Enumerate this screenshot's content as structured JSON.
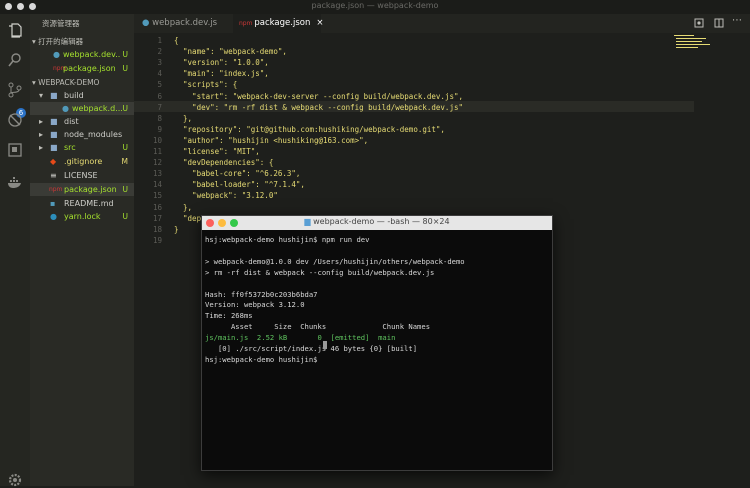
{
  "window": {
    "title": "package.json — webpack-demo"
  },
  "activity": {
    "scm_badge": "6",
    "icons": [
      "files-icon",
      "search-icon",
      "source-control-icon",
      "debug-icon",
      "extensions-icon",
      "docker-icon",
      "settings-gear-icon"
    ]
  },
  "sidebar": {
    "header": "资源管理器",
    "open_editors_label": "▾ 打开的编辑器",
    "open_editors": [
      {
        "name": "webpack.dev..",
        "status": "U"
      },
      {
        "name": "package.json",
        "status": "U"
      }
    ],
    "project_label": "▾ WEBPACK-DEMO",
    "tree": [
      {
        "name": "build",
        "status": "",
        "type": "folder"
      },
      {
        "name": "webpack.d...",
        "status": "U",
        "type": "file"
      },
      {
        "name": "dist",
        "status": "",
        "type": "folder"
      },
      {
        "name": "node_modules",
        "status": "",
        "type": "folder"
      },
      {
        "name": "src",
        "status": "U",
        "type": "folder"
      },
      {
        "name": ".gitignore",
        "status": "M",
        "type": "file"
      },
      {
        "name": "LICENSE",
        "status": "",
        "type": "file"
      },
      {
        "name": "package.json",
        "status": "U",
        "type": "file"
      },
      {
        "name": "README.md",
        "status": "",
        "type": "file"
      },
      {
        "name": "yarn.lock",
        "status": "U",
        "type": "file"
      }
    ]
  },
  "tabs": [
    {
      "label": "webpack.dev.js"
    },
    {
      "label": "package.json",
      "close": "×"
    }
  ],
  "editor": {
    "line_numbers": [
      "1",
      "2",
      "3",
      "4",
      "5",
      "6",
      "7",
      "8",
      "9",
      "10",
      "11",
      "12",
      "13",
      "14",
      "15",
      "16",
      "17",
      "18",
      "19"
    ],
    "lines": [
      "{",
      "  \"name\": \"webpack-demo\",",
      "  \"version\": \"1.0.0\",",
      "  \"main\": \"index.js\",",
      "  \"scripts\": {",
      "    \"start\": \"webpack-dev-server --config build/webpack.dev.js\",",
      "    \"dev\": \"rm -rf dist & webpack --config build/webpack.dev.js\"",
      "  },",
      "  \"repository\": \"git@github.com:hushiking/webpack-demo.git\",",
      "  \"author\": \"hushijin <hushiking@163.com>\",",
      "  \"license\": \"MIT\",",
      "  \"devDependencies\": {",
      "    \"babel-core\": \"^6.26.3\",",
      "    \"babel-loader\": \"^7.1.4\",",
      "    \"webpack\": \"3.12.0\"",
      "  },",
      "  \"dependencies\": {}",
      "}",
      ""
    ]
  },
  "terminal": {
    "title": "webpack-demo — -bash — 80×24",
    "lines": [
      "hsj:webpack-demo hushijin$ npm run dev",
      "",
      "> webpack-demo@1.0.0 dev /Users/hushijin/others/webpack-demo",
      "> rm -rf dist & webpack --config build/webpack.dev.js",
      "",
      "Hash: ff0f5372b0c203b6bda7",
      "Version: webpack 3.12.0",
      "Time: 268ms",
      "      Asset     Size  Chunks             Chunk Names",
      "js/main.js  2.52 kB       0  [emitted]  main",
      "   [0] ./src/script/index.js 46 bytes {0} [built]",
      "hsj:webpack-demo hushijin$ "
    ]
  }
}
